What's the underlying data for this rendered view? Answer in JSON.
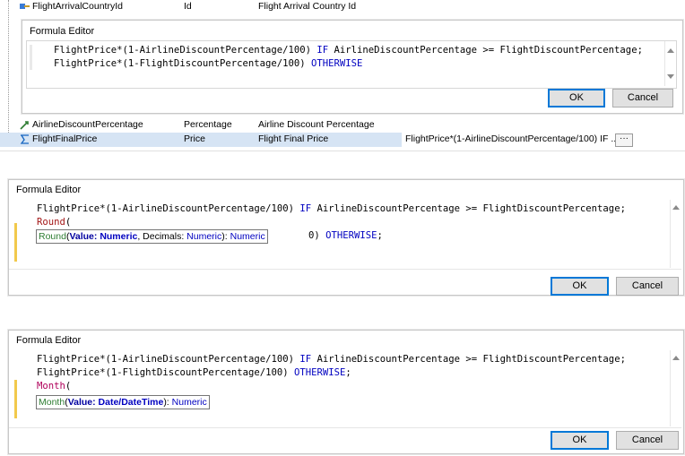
{
  "grid": {
    "top_row": {
      "name": "FlightArrivalCountryId",
      "type": "Id",
      "description": "Flight Arrival Country Id"
    },
    "rows": [
      {
        "name": "AirlineDiscountPercentage",
        "type": "Percentage",
        "description": "Airline Discount Percentage",
        "formula": ""
      },
      {
        "name": "FlightFinalPrice",
        "type": "Price",
        "description": "Flight Final Price",
        "formula": "FlightPrice*(1-AirlineDiscountPercentage/100) IF ...",
        "ellipsis": "···"
      }
    ]
  },
  "editor1": {
    "title": "Formula Editor",
    "line1": {
      "a": "FlightPrice*(1-AirlineDiscountPercentage/100) ",
      "kw": "IF",
      "b": " AirlineDiscountPercentage >= FlightDiscountPercentage;"
    },
    "line2": {
      "a": "FlightPrice*(1-FlightDiscountPercentage/100) ",
      "kw": "OTHERWISE"
    },
    "ok": "OK",
    "cancel": "Cancel"
  },
  "editor2": {
    "title": "Formula Editor",
    "line1": {
      "a": "FlightPrice*(1-AirlineDiscountPercentage/100) ",
      "kw": "IF",
      "b": " AirlineDiscountPercentage >= FlightDiscountPercentage;"
    },
    "line2": {
      "fn": "Round",
      "paren": "("
    },
    "line3_tail": {
      "a": "0) ",
      "kw": "OTHERWISE",
      "b": ";"
    },
    "tooltip": {
      "fn": "Round",
      "open": "(",
      "p1": "Value:",
      "t1": "Numeric",
      "sep": ", Decimals: ",
      "t2": "Numeric",
      "close": "): ",
      "ret": "Numeric"
    },
    "ok": "OK",
    "cancel": "Cancel"
  },
  "editor3": {
    "title": "Formula Editor",
    "line1": {
      "a": "FlightPrice*(1-AirlineDiscountPercentage/100) ",
      "kw": "IF",
      "b": " AirlineDiscountPercentage >= FlightDiscountPercentage;"
    },
    "line2": {
      "a": "FlightPrice*(1-FlightDiscountPercentage/100) ",
      "kw": "OTHERWISE",
      "b": ";"
    },
    "line3": {
      "fn": "Month",
      "paren": "("
    },
    "tooltip": {
      "fn": "Month",
      "open": "(",
      "p1": "Value:",
      "t1": "Date/DateTime",
      "close": "): ",
      "ret": "Numeric"
    },
    "ok": "OK",
    "cancel": "Cancel"
  },
  "colors": {
    "keyword": "#0000c0",
    "function": "#a31515",
    "selection": "#d6e4f4",
    "accent": "#0078d7",
    "margin_marker": "#f2c94c"
  }
}
